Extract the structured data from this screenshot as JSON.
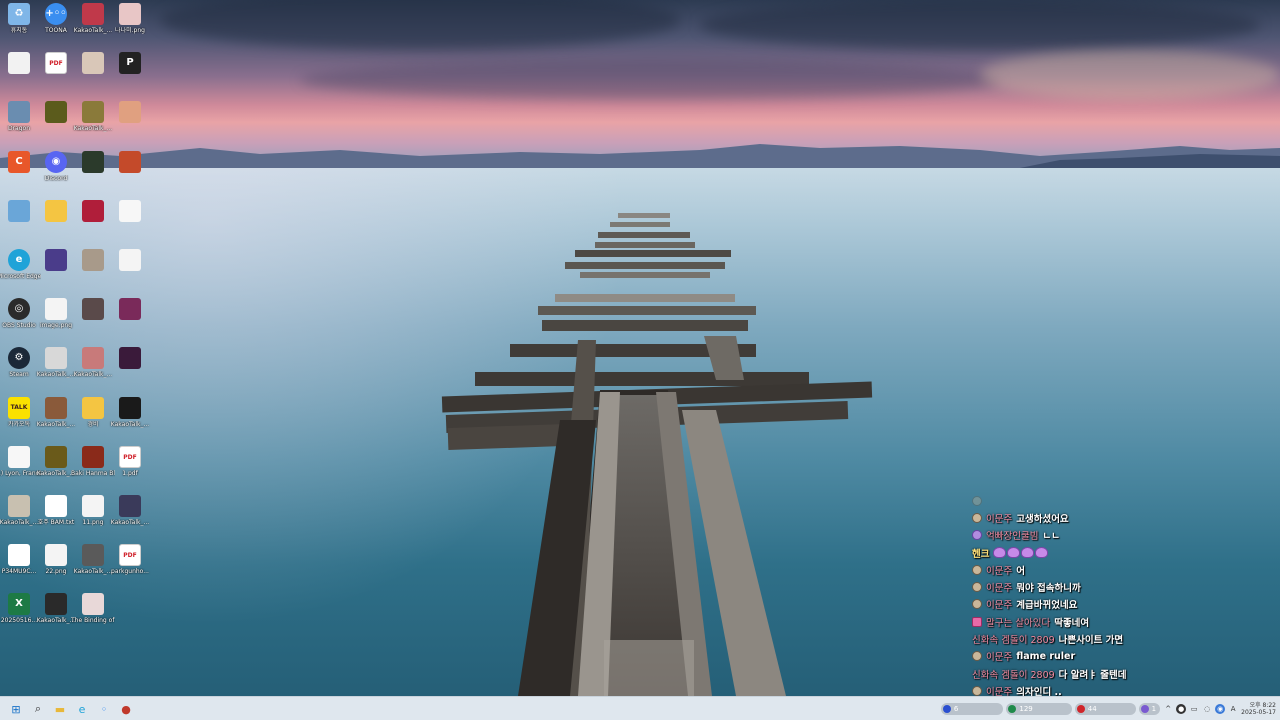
{
  "desktop": {
    "icons": [
      {
        "label": "휴지통",
        "icon": "recycle-bin-icon",
        "color": "#7fb6e8",
        "glyph": "♻"
      },
      {
        "label": "TOONA",
        "icon": "toona-app-icon",
        "color": "#3a8ef0",
        "glyph": "+◦◦"
      },
      {
        "label": "KakaoTalk_...",
        "icon": "image-thumb-icon",
        "color": "#c0394a",
        "glyph": ""
      },
      {
        "label": "나나미.png",
        "icon": "image-thumb-icon",
        "color": "#e8c6c6",
        "glyph": ""
      },
      {
        "label": "",
        "icon": "document-icon",
        "color": "#f2f2f2",
        "glyph": ""
      },
      {
        "label": "",
        "icon": "pdf-file-icon",
        "color": "#ffffff",
        "glyph": "PDF"
      },
      {
        "label": "",
        "icon": "image-thumb-icon",
        "color": "#d9c7b8",
        "glyph": ""
      },
      {
        "label": "",
        "icon": "app-icon",
        "color": "#222222",
        "glyph": "P"
      },
      {
        "label": "Dragon",
        "icon": "dragon-app-icon",
        "color": "#6a8db0",
        "glyph": ""
      },
      {
        "label": "",
        "icon": "image-thumb-icon",
        "color": "#5b5b1c",
        "glyph": ""
      },
      {
        "label": "KakaoTalk_...",
        "icon": "image-thumb-icon",
        "color": "#8a7a3a",
        "glyph": ""
      },
      {
        "label": "",
        "icon": "image-thumb-icon",
        "color": "#e0a080",
        "glyph": ""
      },
      {
        "label": "",
        "icon": "app-icon",
        "color": "#e8572a",
        "glyph": "C"
      },
      {
        "label": "Discord",
        "icon": "discord-icon",
        "color": "#5865f2",
        "glyph": "◉"
      },
      {
        "label": "",
        "icon": "image-thumb-icon",
        "color": "#2b3a2b",
        "glyph": ""
      },
      {
        "label": "",
        "icon": "image-thumb-icon",
        "color": "#c44a2a",
        "glyph": ""
      },
      {
        "label": "",
        "icon": "app-icon",
        "color": "#6aa6d8",
        "glyph": ""
      },
      {
        "label": "",
        "icon": "folder-icon",
        "color": "#f4c542",
        "glyph": ""
      },
      {
        "label": "",
        "icon": "image-thumb-icon",
        "color": "#b01e3a",
        "glyph": ""
      },
      {
        "label": "",
        "icon": "document-icon",
        "color": "#f7f7f7",
        "glyph": ""
      },
      {
        "label": "Microsoft Edge",
        "icon": "edge-browser-icon",
        "color": "#1fa3d8",
        "glyph": "e"
      },
      {
        "label": "",
        "icon": "image-thumb-icon",
        "color": "#4a3c8a",
        "glyph": ""
      },
      {
        "label": "",
        "icon": "image-thumb-icon",
        "color": "#a89a8a",
        "glyph": ""
      },
      {
        "label": "",
        "icon": "image-thumb-icon",
        "color": "#f4f4f4",
        "glyph": ""
      },
      {
        "label": "OBS Studio",
        "icon": "obs-studio-icon",
        "color": "#2b2b2b",
        "glyph": "◎"
      },
      {
        "label": "image.png",
        "icon": "image-thumb-icon",
        "color": "#f4f4f4",
        "glyph": ""
      },
      {
        "label": "",
        "icon": "image-thumb-icon",
        "color": "#5a4a4a",
        "glyph": ""
      },
      {
        "label": "",
        "icon": "image-thumb-icon",
        "color": "#7a2a5a",
        "glyph": ""
      },
      {
        "label": "Steam",
        "icon": "steam-icon",
        "color": "#1b2838",
        "glyph": "⚙"
      },
      {
        "label": "KakaoTalk_...",
        "icon": "image-thumb-icon",
        "color": "#d8d8d8",
        "glyph": ""
      },
      {
        "label": "KakaoTalk_...",
        "icon": "image-thumb-icon",
        "color": "#c87a7a",
        "glyph": ""
      },
      {
        "label": "",
        "icon": "image-thumb-icon",
        "color": "#3a1a3a",
        "glyph": ""
      },
      {
        "label": "카카오톡",
        "icon": "kakaotalk-icon",
        "color": "#fae100",
        "glyph": "TALK"
      },
      {
        "label": "KakaoTalk_...",
        "icon": "image-thumb-icon",
        "color": "#8a5a3a",
        "glyph": ""
      },
      {
        "label": "경비",
        "icon": "folder-icon",
        "color": "#f4c542",
        "glyph": ""
      },
      {
        "label": "KakaoTalk_...",
        "icon": "image-thumb-icon",
        "color": "#1a1a1a",
        "glyph": ""
      },
      {
        "label": "1) Lyon, France ...",
        "icon": "document-icon",
        "color": "#f7f7f7",
        "glyph": ""
      },
      {
        "label": "KakaoTalk_...",
        "icon": "image-thumb-icon",
        "color": "#6a5a1a",
        "glyph": ""
      },
      {
        "label": "Baki Hanma Blood Arena",
        "icon": "game-app-icon",
        "color": "#8a2a1a",
        "glyph": ""
      },
      {
        "label": "1.pdf",
        "icon": "pdf-file-icon",
        "color": "#ffffff",
        "glyph": "PDF"
      },
      {
        "label": "KakaoTalk_...",
        "icon": "image-thumb-icon",
        "color": "#c8c0b0",
        "glyph": ""
      },
      {
        "label": "호주 BAM.txt",
        "icon": "text-file-icon",
        "color": "#ffffff",
        "glyph": ""
      },
      {
        "label": "11.png",
        "icon": "image-thumb-icon",
        "color": "#f4f4f4",
        "glyph": ""
      },
      {
        "label": "KakaoTalk_...",
        "icon": "image-thumb-icon",
        "color": "#3a3a5a",
        "glyph": ""
      },
      {
        "label": "P34MU9C...",
        "icon": "document-icon",
        "color": "#ffffff",
        "glyph": ""
      },
      {
        "label": "22.png",
        "icon": "image-thumb-icon",
        "color": "#f4f4f4",
        "glyph": ""
      },
      {
        "label": "KakaoTalk_...",
        "icon": "image-thumb-icon",
        "color": "#5a5a5a",
        "glyph": ""
      },
      {
        "label": "parkgunho...",
        "icon": "pdf-file-icon",
        "color": "#ffffff",
        "glyph": "PDF"
      },
      {
        "label": "20250516...",
        "icon": "excel-file-icon",
        "color": "#1d7a45",
        "glyph": "X"
      },
      {
        "label": "KakaoTalk_...",
        "icon": "image-thumb-icon",
        "color": "#2a2a2a",
        "glyph": ""
      },
      {
        "label": "The Binding of Isaac R...",
        "icon": "isaac-game-icon",
        "color": "#e8d8d8",
        "glyph": ""
      }
    ]
  },
  "chat": {
    "messages": [
      {
        "nick": "",
        "text": "",
        "badge": "default",
        "faded": true
      },
      {
        "nick": "이문주",
        "text": "고생하셨어요",
        "badge": "default"
      },
      {
        "nick": "억빠장인쿨빔",
        "text": "ㄴㄴ",
        "badge": "purple"
      },
      {
        "nick": "헨크",
        "text": "",
        "badge": "none",
        "emotes": 4,
        "nick_color": "#ffe27a"
      },
      {
        "nick": "이문주",
        "text": "어",
        "badge": "default"
      },
      {
        "nick": "이문주",
        "text": "뭐야 접속하니까",
        "badge": "default"
      },
      {
        "nick": "이문주",
        "text": "계급바뀌었네요",
        "badge": "default"
      },
      {
        "nick": "말구는 살아있다",
        "text": "딱좋네여",
        "badge": "pink"
      },
      {
        "nick": "신화속 겜돌이 2809",
        "text": "나쁜사이트 가면",
        "badge": "none"
      },
      {
        "nick": "이문주",
        "text": "flame ruler",
        "badge": "default"
      },
      {
        "nick": "신화속 겜돌이 2809",
        "text": "다 알려ㅑ 줄텐데",
        "badge": "none"
      },
      {
        "nick": "이문주",
        "text": "의자인디 ..",
        "badge": "default"
      }
    ]
  },
  "taskbar": {
    "buttons": [
      {
        "name": "start-button",
        "glyph": "⊞",
        "color": "#1a73c8"
      },
      {
        "name": "search-button",
        "glyph": "⌕",
        "color": "#333333"
      },
      {
        "name": "file-explorer-button",
        "glyph": "▬",
        "color": "#e8b83a"
      },
      {
        "name": "edge-button",
        "glyph": "e",
        "color": "#1fa3d8"
      },
      {
        "name": "toona-button",
        "glyph": "◦",
        "color": "#3a8ef0"
      },
      {
        "name": "app-button",
        "glyph": "●",
        "color": "#c0392b"
      }
    ],
    "tray": {
      "pill_1": "6",
      "pill_2": "129",
      "pill_3": "44",
      "pill_4": "1",
      "lang": "A",
      "clock_time": "오후 8:22",
      "clock_date": "2025-05-17"
    }
  },
  "colors": {
    "taskbar_bg": "#dfe7ee",
    "chat_nick": "#f08aa0"
  }
}
